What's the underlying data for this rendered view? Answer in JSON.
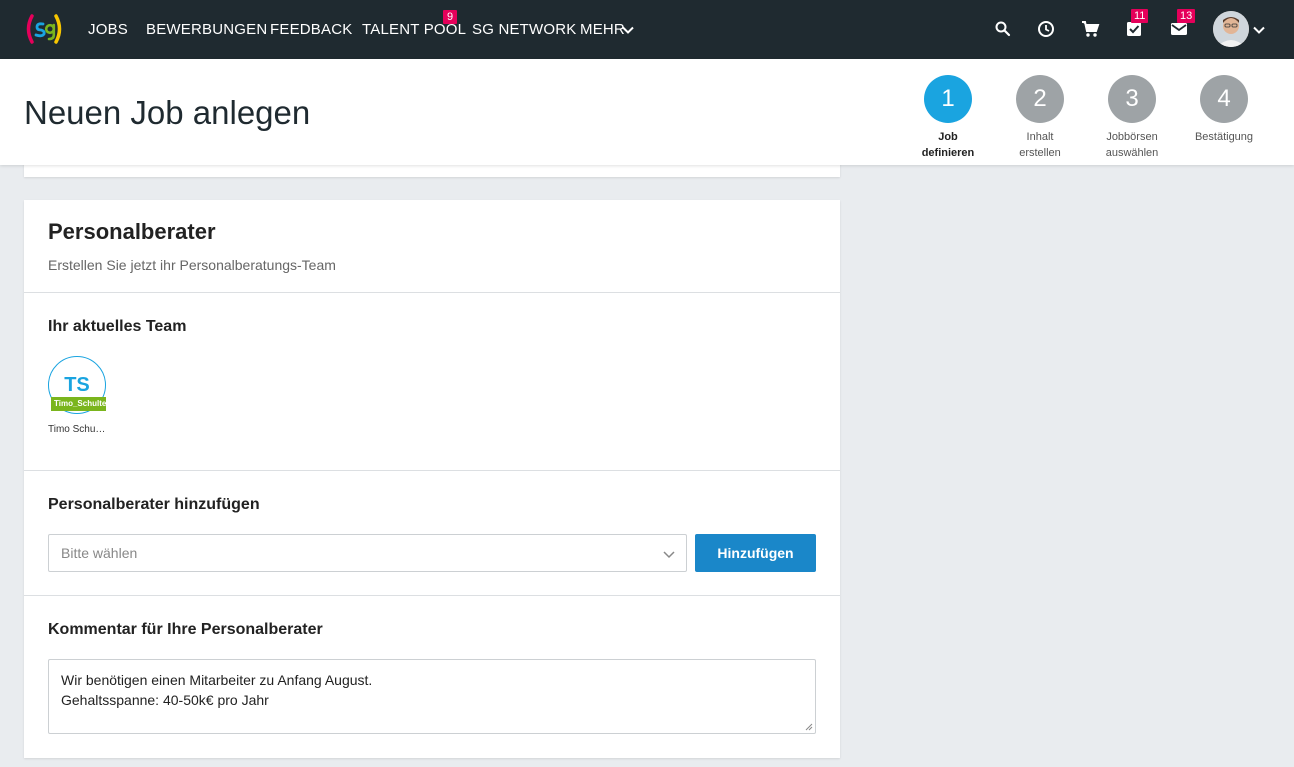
{
  "nav": {
    "logo_alt": "sg",
    "items": [
      "JOBS",
      "BEWERBUNGEN",
      "FEEDBACK",
      "TALENT POOL",
      "SG NETWORK",
      "MEHR"
    ],
    "talent_pool_badge": "9",
    "tasks_badge": "11",
    "messages_badge": "13",
    "icons": [
      "search-icon",
      "clock-icon",
      "cart-icon",
      "tasks-icon",
      "mail-icon",
      "avatar",
      "chevron-down-icon"
    ]
  },
  "header": {
    "title": "Neuen Job anlegen",
    "steps": [
      {
        "number": "1",
        "line1": "Job",
        "line2": "definieren",
        "state": "active"
      },
      {
        "number": "2",
        "line1": "Inhalt",
        "line2": "erstellen",
        "state": "inactive"
      },
      {
        "number": "3",
        "line1": "Jobbörsen",
        "line2": "auswählen",
        "state": "inactive"
      },
      {
        "number": "4",
        "line1": "Bestätigung",
        "line2": "",
        "state": "inactive"
      }
    ]
  },
  "card": {
    "title": "Personalberater",
    "subtitle": "Erstellen Sie jetzt ihr Personalberatungs-Team",
    "team": {
      "title": "Ihr aktuelles Team",
      "members": [
        {
          "initials": "TS",
          "tag": "Timo_Schulte",
          "name": "Timo Schu…"
        }
      ]
    },
    "add": {
      "title": "Personalberater hinzufügen",
      "placeholder": "Bitte wählen",
      "button": "Hinzufügen"
    },
    "comment": {
      "title": "Kommentar für Ihre Personalberater",
      "line1": "Wir benötigen einen Mitarbeiter zu Anfang August.",
      "line2": "Gehaltsspanne: 40-50k€ pro Jahr"
    }
  },
  "colors": {
    "nav_bg": "#1f2a30",
    "accent": "#1aa4e0",
    "button": "#1a87c9",
    "badge": "#e5005a",
    "tag": "#7ab51d",
    "step_inactive": "#9ea3a6"
  }
}
